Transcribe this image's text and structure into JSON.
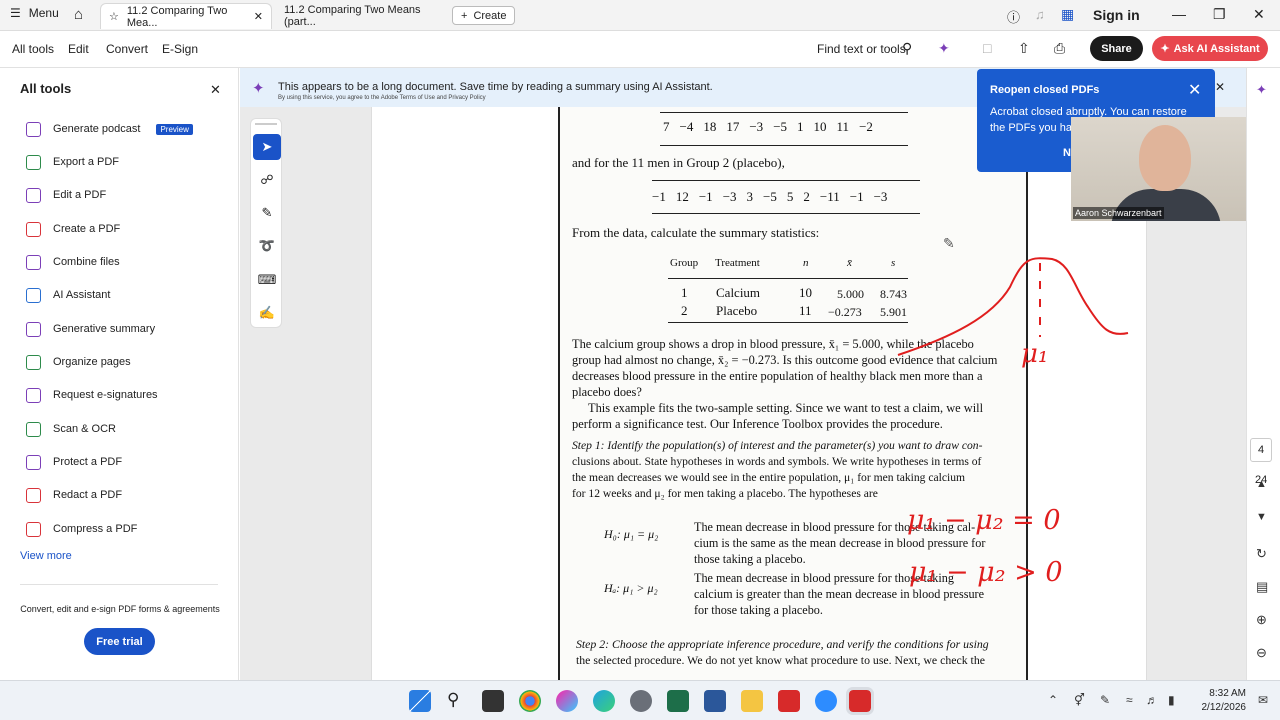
{
  "window": {
    "menu_label": "Menu",
    "tabs": [
      {
        "label": "11.2 Comparing Two Mea..."
      },
      {
        "label": "11.2 Comparing Two Means (part..."
      }
    ],
    "create_label": "Create",
    "signin_label": "Sign in"
  },
  "toolbar": {
    "items": [
      "All tools",
      "Edit",
      "Convert",
      "E-Sign"
    ],
    "find_label": "Find text or tools",
    "share_label": "Share",
    "ask_ai_label": "Ask AI Assistant"
  },
  "sidebar": {
    "title": "All tools",
    "items": [
      {
        "label": "Generate podcast",
        "badge": "Preview",
        "icon": "podcast-icon"
      },
      {
        "label": "Export a PDF",
        "icon": "export-icon"
      },
      {
        "label": "Edit a PDF",
        "icon": "edit-icon"
      },
      {
        "label": "Create a PDF",
        "icon": "create-pdf-icon"
      },
      {
        "label": "Combine files",
        "icon": "combine-icon"
      },
      {
        "label": "AI Assistant",
        "icon": "ai-icon"
      },
      {
        "label": "Generative summary",
        "icon": "summary-icon"
      },
      {
        "label": "Organize pages",
        "icon": "organize-icon"
      },
      {
        "label": "Request e-signatures",
        "icon": "signature-icon"
      },
      {
        "label": "Scan & OCR",
        "icon": "scan-icon"
      },
      {
        "label": "Protect a PDF",
        "icon": "protect-icon"
      },
      {
        "label": "Redact a PDF",
        "icon": "redact-icon"
      },
      {
        "label": "Compress a PDF",
        "icon": "compress-icon"
      }
    ],
    "view_more": "View more",
    "promo": "Convert, edit and e-sign PDF forms & agreements",
    "trial_label": "Free trial"
  },
  "banner": {
    "message": "This appears to be a long document. Save time by reading a summary using AI Assistant.",
    "legal": "By using this service, you agree to the Adobe Terms of Use and Privacy Policy"
  },
  "toast": {
    "title": "Reopen closed PDFs",
    "body": "Acrobat closed abruptly. You can restore the PDFs you had ope",
    "action": "N"
  },
  "webcam": {
    "name": "Aaron Schwarzenbart"
  },
  "document": {
    "group1_row": [
      "7",
      "−4",
      "18",
      "17",
      "−3",
      "−5",
      "1",
      "10",
      "11",
      "−2"
    ],
    "group2_intro": "and for the 11 men in Group 2 (placebo),",
    "group2_row": [
      "−1",
      "12",
      "−1",
      "−3",
      "3",
      "−5",
      "5",
      "2",
      "−11",
      "−1",
      "−3"
    ],
    "summary_intro": "From the data, calculate the summary statistics:",
    "table_headers": [
      "Group",
      "Treatment",
      "n",
      "x̄",
      "s"
    ],
    "table_rows": [
      [
        "1",
        "Calcium",
        "10",
        "5.000",
        "8.743"
      ],
      [
        "2",
        "Placebo",
        "11",
        "−0.273",
        "5.901"
      ]
    ],
    "para1": [
      "The calcium group shows a drop in blood pressure, x̄₁ = 5.000, while the placebo",
      "group had almost no change, x̄₂ = −0.273. Is this outcome good evidence that calcium",
      "decreases blood pressure in the entire population of healthy black men more than a",
      "placebo does?"
    ],
    "para2": [
      "This example fits the two-sample setting. Since we want to test a claim, we will",
      "perform a significance test. Our Inference Toolbox provides the procedure."
    ],
    "step1": [
      "Step 1: Identify the population(s) of interest and the parameter(s) you want to draw con-",
      "clusions about. State hypotheses in words and symbols. We write hypotheses in terms of",
      "the mean decreases we would see in the entire population, μ₁ for men taking calcium",
      "for 12 weeks and μ₂ for men taking a placebo. The hypotheses are"
    ],
    "h0_label": "H₀: μ₁ = μ₂",
    "h0_text": [
      "The mean decrease in blood pressure for those taking cal-",
      "cium is the same as the mean decrease in blood pressure for",
      "those taking a placebo."
    ],
    "ha_label": "Hₐ: μ₁ > μ₂",
    "ha_text": [
      "The mean decrease in blood pressure for those taking",
      "calcium is greater than the mean decrease in blood pressure",
      "for those taking a placebo."
    ],
    "step2": [
      "Step 2: Choose the appropriate inference procedure, and verify the conditions for using",
      "the selected procedure. We do not yet know what procedure to use. Next, we check the"
    ]
  },
  "annotations": {
    "mu_label": "μ₁",
    "eq1": "μ₁ − μ₂ = 0",
    "eq2": "μ₁ − μ₂ > 0",
    "ink_color": "#e01e1e"
  },
  "page_nav": {
    "current": "4",
    "total": "24"
  },
  "clock": {
    "time": "8:32 AM",
    "date": "2/12/2026"
  },
  "colors": {
    "accent": "#1a53c8",
    "ai_red": "#e8464d",
    "toast_blue": "#1a5ccf"
  }
}
